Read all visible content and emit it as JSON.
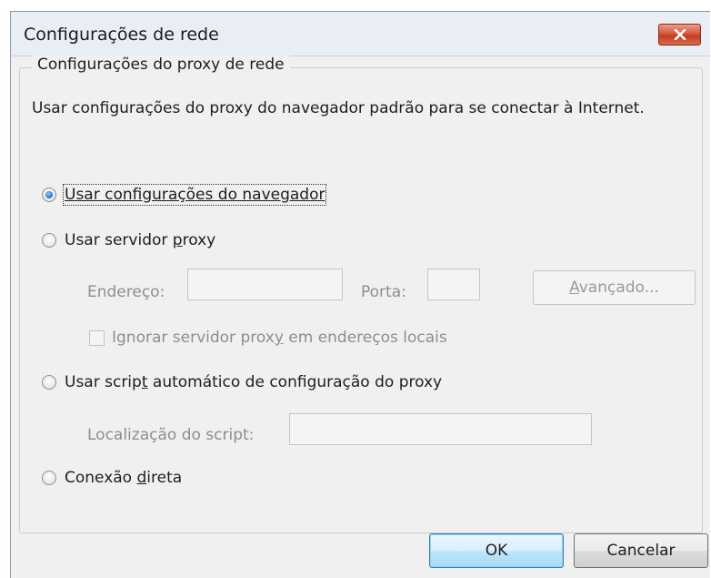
{
  "window": {
    "title": "Configurações de rede"
  },
  "group": {
    "legend": "Configurações do proxy de rede",
    "description": "Usar configurações do proxy do navegador padrão para se conectar à Internet."
  },
  "options": {
    "browser": {
      "label": "Usar configurações do navegador",
      "selected": true
    },
    "proxy": {
      "label_pre": "Usar servidor ",
      "label_u": "p",
      "label_post": "roxy",
      "selected": false
    },
    "auto_script": {
      "label_pre": "Usar scrip",
      "label_u": "t",
      "label_post": " automático de configuração do proxy",
      "selected": false
    },
    "direct": {
      "label_pre": "Conexão ",
      "label_u": "d",
      "label_post": "ireta",
      "selected": false
    }
  },
  "proxy_settings": {
    "address_label": "Endereço:",
    "address_value": "",
    "port_label": "Porta:",
    "port_value": "",
    "advanced_pre": "",
    "advanced_u": "A",
    "advanced_post": "vançado...",
    "bypass_pre": "Ignorar servidor prox",
    "bypass_u": "y",
    "bypass_post": " em endereços locais",
    "bypass_checked": false
  },
  "script_settings": {
    "location_label": "Localização do script:",
    "location_value": ""
  },
  "buttons": {
    "ok": "OK",
    "cancel": "Cancelar"
  },
  "colors": {
    "close_button": "#c43c1e",
    "window_bg": "#f0f0f0",
    "disabled_text": "#8e8e8e"
  }
}
